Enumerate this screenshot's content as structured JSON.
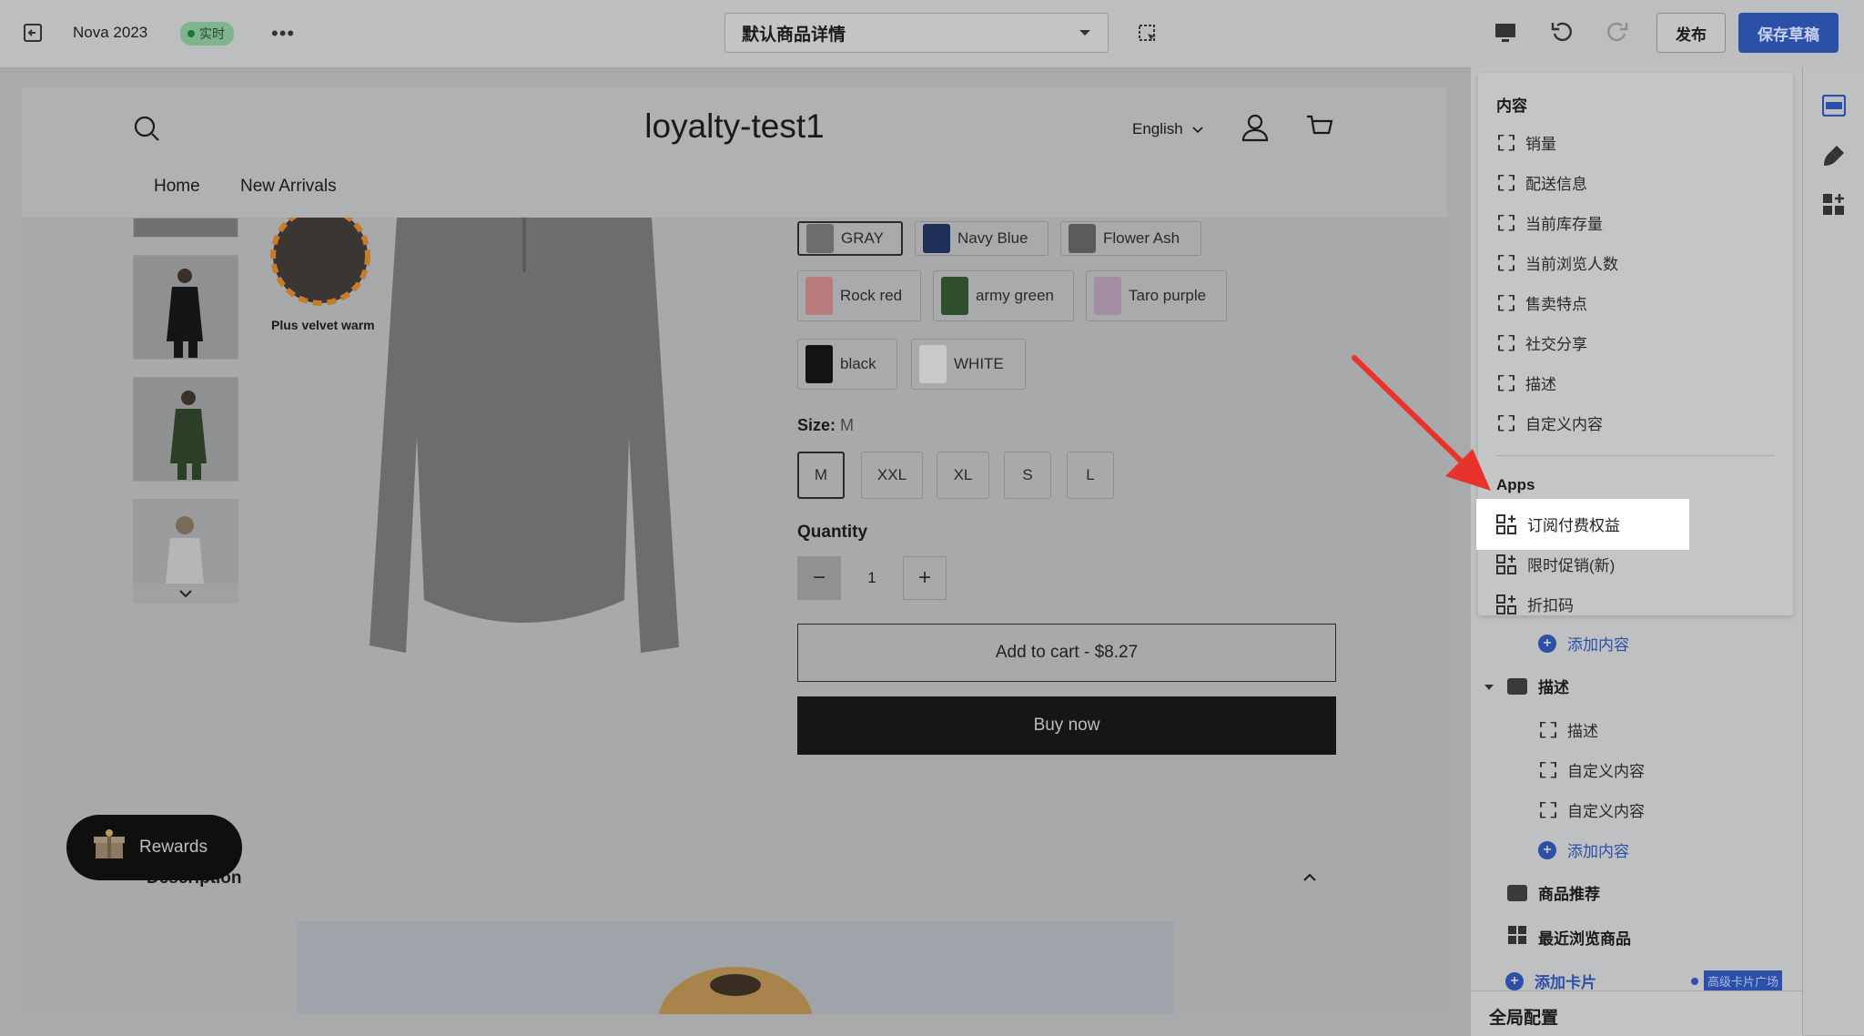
{
  "topbar": {
    "store_name": "Nova 2023",
    "live_badge": "实时",
    "template_select": "默认商品详情",
    "publish": "发布",
    "save_draft": "保存草稿"
  },
  "preview": {
    "store_title": "loyalty-test1",
    "language": "English",
    "nav": [
      "Home",
      "New Arrivals"
    ],
    "image_caption": "Plus velvet warm",
    "colors": [
      {
        "label": "GRAY",
        "color": "#6c6d6e"
      },
      {
        "label": "Navy Blue",
        "color": "#1e2f58"
      },
      {
        "label": "Flower Ash",
        "color": "#5a5b5c"
      },
      {
        "label": "Rock red",
        "color": "#b87c7c"
      },
      {
        "label": "army green",
        "color": "#2f4e2b"
      },
      {
        "label": "Taro purple",
        "color": "#a48ea4"
      },
      {
        "label": "black",
        "color": "#141414"
      },
      {
        "label": "WHITE",
        "color": "#c9c9cc"
      }
    ],
    "size_label": "Size:",
    "size_value": "M",
    "sizes": [
      "M",
      "XXL",
      "XL",
      "S",
      "L"
    ],
    "quantity_label": "Quantity",
    "quantity_value": "1",
    "add_to_cart": "Add to cart  -  $8.27",
    "buy_now": "Buy now",
    "rewards": "Rewards",
    "description": "Description"
  },
  "panel": {
    "content_title": "内容",
    "content_items": [
      "销量",
      "配送信息",
      "当前库存量",
      "当前浏览人数",
      "售卖特点",
      "社交分享",
      "描述",
      "自定义内容"
    ],
    "apps_title": "Apps",
    "app_items": [
      "订阅付费权益",
      "限时促销(新)",
      "折扣码"
    ],
    "add_content": "添加内容",
    "desc_section": "描述",
    "desc_items": [
      "描述",
      "自定义内容",
      "自定义内容"
    ],
    "add_content_2": "添加内容",
    "recommend": "商品推荐",
    "recent": "最近浏览商品",
    "add_card": "添加卡片",
    "card_badge": "高级卡片广场",
    "global_config": "全局配置"
  }
}
